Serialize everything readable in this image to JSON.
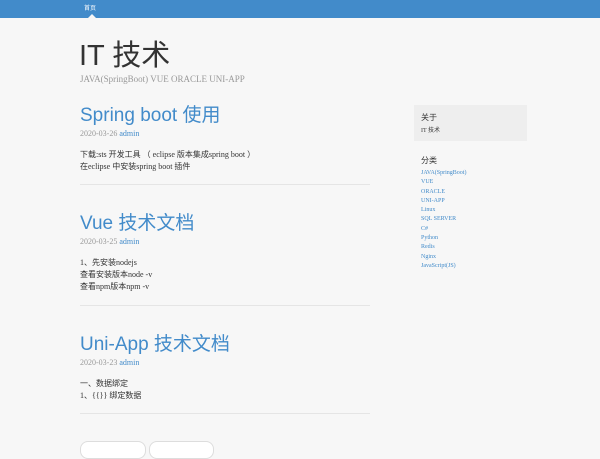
{
  "nav": {
    "home_label": "首页"
  },
  "blog": {
    "title": "IT 技术",
    "description": "JAVA(SpringBoot) VUE ORACLE UNI-APP"
  },
  "posts": [
    {
      "title": "Spring boot 使用",
      "date": "2020-03-26",
      "author": "admin",
      "lines": [
        "下载:sts 开发工具 （ eclipse 版本集成spring boot ）",
        "在eclipse 中安装spring boot 插件"
      ]
    },
    {
      "title": "Vue 技术文档",
      "date": "2020-03-25",
      "author": "admin",
      "lines": [
        "1、先安装nodejs",
        "查看安装版本node -v",
        "查看npm版本npm -v"
      ]
    },
    {
      "title": "Uni-App 技术文档",
      "date": "2020-03-23",
      "author": "admin",
      "lines": [
        "一、数据绑定",
        "1、{{}} 绑定数据"
      ]
    }
  ],
  "sidebar": {
    "about_title": "关于",
    "about_text": "IT 技术",
    "categories_title": "分类",
    "categories": [
      "JAVA(SpringBoot)",
      "VUE",
      "ORACLE",
      "UNI-APP",
      "Linux",
      "SQL SERVER",
      "C#",
      "Python",
      "Redis",
      "Nginx",
      "JavaScript(JS)"
    ]
  },
  "colors": {
    "accent": "#428bca",
    "background": "#f7f7f7"
  }
}
